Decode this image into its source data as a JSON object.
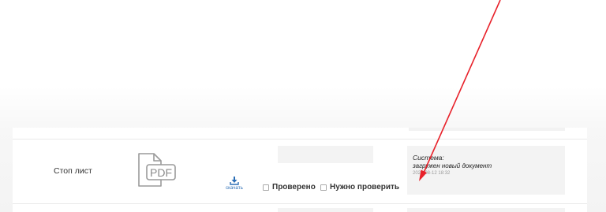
{
  "document_row": {
    "name": "Стоп лист",
    "file_icon": "pdf-file-icon",
    "file_icon_label": "PDF",
    "download_label": "скачать",
    "checkboxes": [
      {
        "label": "Проверено",
        "checked": false
      },
      {
        "label": "Нужно проверить",
        "checked": false
      }
    ],
    "note": {
      "author": "Система:",
      "text": "загружен новый документ",
      "date": "2025-08-12 18:32"
    }
  },
  "colors": {
    "annotation_arrow": "#e8212a",
    "link_blue": "#2a6db5",
    "note_background": "#f3f3f3"
  }
}
